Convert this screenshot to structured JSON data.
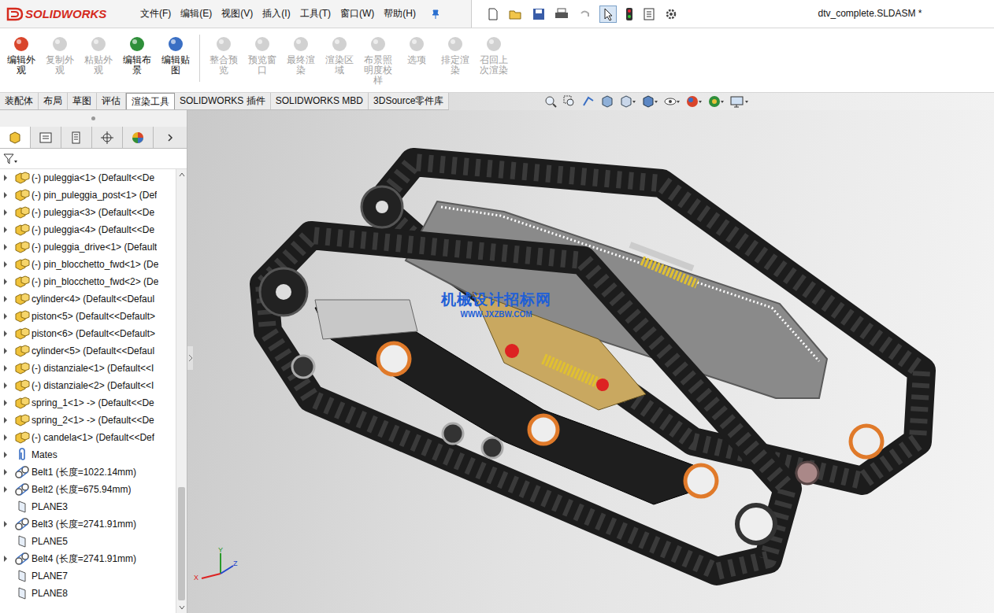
{
  "window": {
    "title": "dtv_complete.SLDASM *",
    "logo": "SOLIDWORKS"
  },
  "menus": [
    "文件(F)",
    "编辑(E)",
    "视图(V)",
    "插入(I)",
    "工具(T)",
    "窗口(W)",
    "帮助(H)"
  ],
  "ribbon": [
    {
      "label": "编辑外观",
      "disabled": false,
      "color": "#d9452b"
    },
    {
      "label": "复制外观",
      "disabled": true,
      "color": "#9a9a9a"
    },
    {
      "label": "粘贴外观",
      "disabled": true,
      "color": "#9a9a9a"
    },
    {
      "label": "编辑布景",
      "disabled": false,
      "color": "#2f8f3a"
    },
    {
      "label": "编辑贴图",
      "disabled": false,
      "color": "#3a6fc4"
    },
    {
      "label": "整合预览",
      "disabled": true,
      "color": "#9a9a9a"
    },
    {
      "label": "预览窗口",
      "disabled": true,
      "color": "#9a9a9a"
    },
    {
      "label": "最终渲染",
      "disabled": true,
      "color": "#9a9a9a"
    },
    {
      "label": "渲染区域",
      "disabled": true,
      "color": "#9a9a9a"
    },
    {
      "label": "布景照明度校样",
      "disabled": true,
      "color": "#9a9a9a"
    },
    {
      "label": "选项",
      "disabled": true,
      "color": "#9a9a9a"
    },
    {
      "label": "排定渲染",
      "disabled": true,
      "color": "#9a9a9a"
    },
    {
      "label": "召回上次渲染",
      "disabled": true,
      "color": "#9a9a9a"
    }
  ],
  "command_tabs": [
    {
      "label": "装配体",
      "selected": false
    },
    {
      "label": "布局",
      "selected": false
    },
    {
      "label": "草图",
      "selected": false
    },
    {
      "label": "评估",
      "selected": false
    },
    {
      "label": "渲染工具",
      "selected": true
    },
    {
      "label": "SOLIDWORKS 插件",
      "selected": false
    },
    {
      "label": "SOLIDWORKS MBD",
      "selected": false
    },
    {
      "label": "3DSource零件库",
      "selected": false
    }
  ],
  "tree": [
    {
      "text": "(-) puleggia<1> (Default<<De",
      "kind": "part",
      "expandable": true
    },
    {
      "text": "(-) pin_puleggia_post<1> (Def",
      "kind": "part",
      "expandable": true
    },
    {
      "text": "(-) puleggia<3> (Default<<De",
      "kind": "part",
      "expandable": true
    },
    {
      "text": "(-) puleggia<4> (Default<<De",
      "kind": "part",
      "expandable": true
    },
    {
      "text": "(-) puleggia_drive<1> (Default",
      "kind": "part",
      "expandable": true
    },
    {
      "text": "(-) pin_blocchetto_fwd<1> (De",
      "kind": "part",
      "expandable": true
    },
    {
      "text": "(-) pin_blocchetto_fwd<2> (De",
      "kind": "part",
      "expandable": true
    },
    {
      "text": "cylinder<4> (Default<<Defaul",
      "kind": "part",
      "expandable": true
    },
    {
      "text": "piston<5> (Default<<Default>",
      "kind": "part",
      "expandable": true
    },
    {
      "text": "piston<6> (Default<<Default>",
      "kind": "part",
      "expandable": true
    },
    {
      "text": "cylinder<5> (Default<<Defaul",
      "kind": "part",
      "expandable": true
    },
    {
      "text": "(-) distanziale<1> (Default<<I",
      "kind": "part",
      "expandable": true
    },
    {
      "text": "(-) distanziale<2> (Default<<I",
      "kind": "part",
      "expandable": true
    },
    {
      "text": "spring_1<1> -> (Default<<De",
      "kind": "part",
      "expandable": true
    },
    {
      "text": "spring_2<1> -> (Default<<De",
      "kind": "part",
      "expandable": true
    },
    {
      "text": "(-) candela<1> (Default<<Def",
      "kind": "part",
      "expandable": true
    },
    {
      "text": "Mates",
      "kind": "mates",
      "expandable": true
    },
    {
      "text": "Belt1 (长度=1022.14mm)",
      "kind": "belt",
      "expandable": true
    },
    {
      "text": "Belt2 (长度=675.94mm)",
      "kind": "belt",
      "expandable": true
    },
    {
      "text": "PLANE3",
      "kind": "plane",
      "expandable": false
    },
    {
      "text": "Belt3 (长度=2741.91mm)",
      "kind": "belt",
      "expandable": true
    },
    {
      "text": "PLANE5",
      "kind": "plane",
      "expandable": false
    },
    {
      "text": "Belt4 (长度=2741.91mm)",
      "kind": "belt",
      "expandable": true
    },
    {
      "text": "PLANE7",
      "kind": "plane",
      "expandable": false
    },
    {
      "text": "PLANE8",
      "kind": "plane",
      "expandable": false
    }
  ],
  "watermark": {
    "title": "机械设计招标网",
    "url": "WWW.JXZBW.COM"
  },
  "triad": {
    "x": "X",
    "y": "Y",
    "z": "Z"
  }
}
